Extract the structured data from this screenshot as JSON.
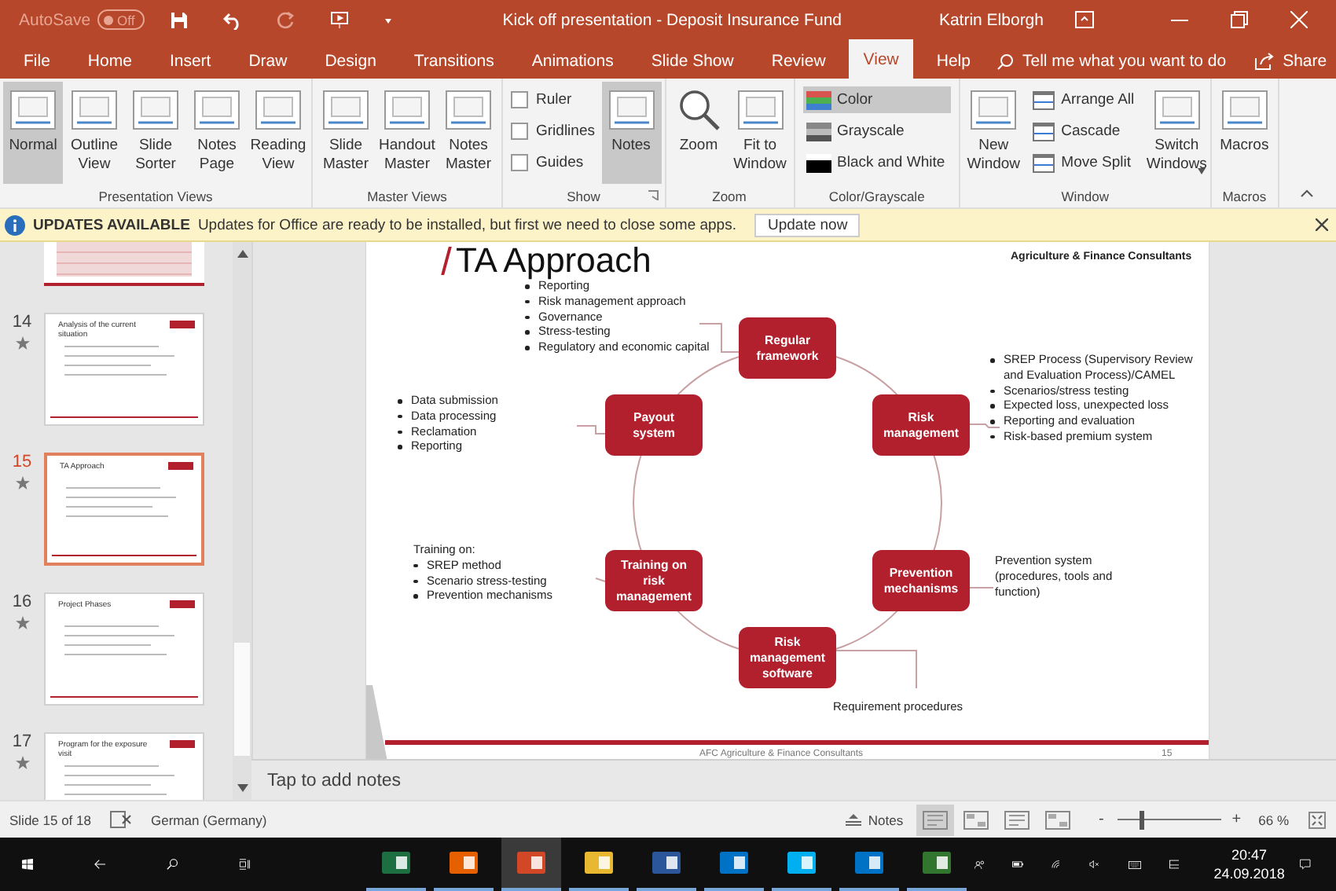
{
  "title_bar": {
    "autosave_label": "AutoSave",
    "autosave_toggle": {
      "label": "Off",
      "on": false
    },
    "title": "Kick off presentation - Deposit Insurance Fund",
    "user": "Katrin Elborgh"
  },
  "menu_tabs": [
    {
      "label": "File",
      "selected": false
    },
    {
      "label": "Home",
      "selected": false
    },
    {
      "label": "Insert",
      "selected": false
    },
    {
      "label": "Draw",
      "selected": false
    },
    {
      "label": "Design",
      "selected": false
    },
    {
      "label": "Transitions",
      "selected": false
    },
    {
      "label": "Animations",
      "selected": false
    },
    {
      "label": "Slide Show",
      "selected": false
    },
    {
      "label": "Review",
      "selected": false
    },
    {
      "label": "View",
      "selected": true
    },
    {
      "label": "Help",
      "selected": false
    }
  ],
  "tell_me": {
    "placeholder": "Tell me what you want to do"
  },
  "share_label": "Share",
  "ribbon_groups": [
    {
      "label": "Presentation Views",
      "items": [
        {
          "kind": "large",
          "label": "Normal",
          "selected": true
        },
        {
          "kind": "large",
          "label": "Outline View",
          "selected": false
        },
        {
          "kind": "large",
          "label": "Slide Sorter",
          "selected": false
        },
        {
          "kind": "large",
          "label": "Notes Page",
          "selected": false
        },
        {
          "kind": "large",
          "label": "Reading View",
          "selected": false
        }
      ]
    },
    {
      "label": "Master Views",
      "items": [
        {
          "kind": "large",
          "label": "Slide Master",
          "selected": false
        },
        {
          "kind": "large",
          "label": "Handout Master",
          "selected": false
        },
        {
          "kind": "large",
          "label": "Notes Master",
          "selected": false
        }
      ]
    },
    {
      "label": "Show",
      "launcher": true,
      "items": [
        {
          "kind": "check",
          "label": "Ruler",
          "checked": false
        },
        {
          "kind": "check",
          "label": "Gridlines",
          "checked": false
        },
        {
          "kind": "check",
          "label": "Guides",
          "checked": false
        },
        {
          "kind": "large",
          "label": "Notes",
          "selected": true
        }
      ]
    },
    {
      "label": "Zoom",
      "items": [
        {
          "kind": "large",
          "label": "Zoom",
          "selected": false
        },
        {
          "kind": "large",
          "label": "Fit to Window",
          "selected": false
        }
      ]
    },
    {
      "label": "Color/Grayscale",
      "items": [
        {
          "kind": "small",
          "label": "Color",
          "selected": true
        },
        {
          "kind": "small",
          "label": "Grayscale",
          "selected": false
        },
        {
          "kind": "small",
          "label": "Black and White",
          "selected": false
        }
      ]
    },
    {
      "label": "Window",
      "items": [
        {
          "kind": "large",
          "label": "New Window",
          "selected": false
        },
        {
          "kind": "small",
          "label": "Arrange All",
          "selected": false
        },
        {
          "kind": "small",
          "label": "Cascade",
          "selected": false
        },
        {
          "kind": "small",
          "label": "Move Split",
          "selected": false
        },
        {
          "kind": "large",
          "label": "Switch Windows",
          "selected": false,
          "dropdown": true
        }
      ]
    },
    {
      "label": "Macros",
      "items": [
        {
          "kind": "large",
          "label": "Macros",
          "selected": false
        }
      ]
    }
  ],
  "update_bar": {
    "title": "UPDATES AVAILABLE",
    "message": "Updates for Office are ready to be installed, but first we need to close some apps.",
    "button": "Update now"
  },
  "thumbnails": [
    {
      "number": "14",
      "title": "Analysis of the current situation",
      "selected": false
    },
    {
      "number": "15",
      "title": "TA Approach",
      "selected": true
    },
    {
      "number": "16",
      "title": "Project Phases",
      "selected": false
    },
    {
      "number": "17",
      "title": "Program for the exposure visit",
      "selected": false
    }
  ],
  "slide": {
    "title": "TA Approach",
    "company": "Agriculture & Finance Consultants",
    "nodes": [
      {
        "label": "Regular framework"
      },
      {
        "label": "Payout system"
      },
      {
        "label": "Risk management"
      },
      {
        "label": "Training on risk management"
      },
      {
        "label": "Prevention mechanisms"
      },
      {
        "label": "Risk management software"
      }
    ],
    "notes": [
      {
        "kind": "bullets",
        "bullets": [
          "Reporting",
          "Risk management approach",
          "Governance",
          "Stress-testing",
          "Regulatory and economic capital"
        ]
      },
      {
        "kind": "bullets",
        "bullets": [
          "SREP Process (Supervisory Review and Evaluation Process)/CAMEL",
          "Scenarios/stress testing",
          "Expected loss, unexpected loss",
          "Reporting and evaluation",
          "Risk-based premium system"
        ]
      },
      {
        "kind": "bullets",
        "bullets": [
          "Data submission",
          "Data processing",
          "Reclamation",
          "Reporting"
        ]
      },
      {
        "kind": "bullets",
        "heading": "Training on:",
        "bullets": [
          "SREP method",
          "Scenario stress-testing",
          "Prevention mechanisms"
        ]
      },
      {
        "kind": "text",
        "text": "Prevention system (procedures, tools and function)"
      },
      {
        "kind": "text",
        "text": "Requirement procedures"
      }
    ],
    "footer": "AFC Agriculture & Finance Consultants",
    "page_number": "15"
  },
  "notes_pane": {
    "placeholder": "Tap to add notes"
  },
  "status_bar": {
    "slide_info": "Slide 15 of 18",
    "language": "German (Germany)",
    "notes_button": "Notes",
    "view_buttons": [
      {
        "selected": true
      },
      {
        "selected": false
      },
      {
        "selected": false
      },
      {
        "selected": false
      }
    ],
    "zoom_out": "-",
    "zoom_in": "+",
    "zoom_slider": {
      "level": 0.22
    },
    "zoom_value": "66 %"
  },
  "taskbar": {
    "apps": [
      {
        "color": "#1d6f42",
        "selected": false
      },
      {
        "color": "#e66000",
        "selected": false
      },
      {
        "color": "#d24726",
        "selected": true
      },
      {
        "color": "#e8b830",
        "selected": false
      },
      {
        "color": "#2b579a",
        "selected": false
      },
      {
        "color": "#0072c6",
        "selected": false
      },
      {
        "color": "#00aff0",
        "selected": false
      },
      {
        "color": "#0072c6",
        "selected": false
      },
      {
        "color": "#31752f",
        "selected": false
      }
    ],
    "time": "20:47",
    "date": "24.09.2018"
  }
}
